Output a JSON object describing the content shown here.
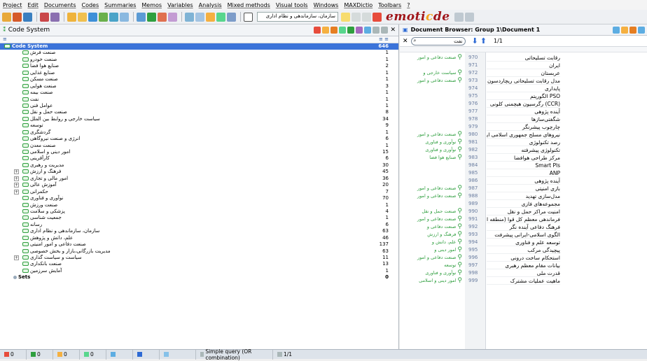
{
  "menu": [
    "Project",
    "Edit",
    "Documents",
    "Codes",
    "Summaries",
    "Memos",
    "Variables",
    "Analysis",
    "Mixed methods",
    "Visual tools",
    "Windows",
    "MAXDictio",
    "Toolbars",
    "?"
  ],
  "toolbar": {
    "filter_value": "سازمان، سازماندهی و نظام اداری",
    "logo_a": "emoti",
    "logo_b": "c",
    "logo_c": "de"
  },
  "code_system": {
    "title": "Code System",
    "col_left": "≡",
    "col_right": "≡ ≡",
    "root": {
      "label": "Code System",
      "count": "646"
    },
    "codes": [
      {
        "label": "صنعت فرش",
        "count": "1",
        "exp": false
      },
      {
        "label": "صنعت خودرو",
        "count": "1",
        "exp": false
      },
      {
        "label": "صنایع هوا فضا",
        "count": "2",
        "exp": false
      },
      {
        "label": "صنایع غذایی",
        "count": "1",
        "exp": false
      },
      {
        "label": "صنعت مسکن",
        "count": "1",
        "exp": false
      },
      {
        "label": "صنعت هوایی",
        "count": "3",
        "exp": false
      },
      {
        "label": "صنعت بیمه",
        "count": "1",
        "exp": false
      },
      {
        "label": "نفت",
        "count": "1",
        "exp": false
      },
      {
        "label": "عوامل فنی",
        "count": "1",
        "exp": false
      },
      {
        "label": "صنعت حمل و نقل",
        "count": "8",
        "exp": false
      },
      {
        "label": "سیاست خارجی و روابط بین الملل",
        "count": "34",
        "exp": false
      },
      {
        "label": "توسعه",
        "count": "9",
        "exp": false
      },
      {
        "label": "گردشگری",
        "count": "1",
        "exp": false
      },
      {
        "label": "انرژی و صنعت نیروگاهی",
        "count": "6",
        "exp": false
      },
      {
        "label": "صنعت معدن",
        "count": "1",
        "exp": false
      },
      {
        "label": "امور دینی و اسلامی",
        "count": "15",
        "exp": false
      },
      {
        "label": "کارآفرینی",
        "count": "6",
        "exp": false
      },
      {
        "label": "مدیریت و رهبری",
        "count": "30",
        "exp": false
      },
      {
        "label": "فرهنگ و ارزش",
        "count": "45",
        "exp": true
      },
      {
        "label": "امور مالی و تجاری",
        "count": "36",
        "exp": true
      },
      {
        "label": "آموزش عالی",
        "count": "20",
        "exp": true
      },
      {
        "label": "حکمرانی",
        "count": "7",
        "exp": true
      },
      {
        "label": "نوآوری و فناوری",
        "count": "70",
        "exp": false
      },
      {
        "label": "صنعت ورزش",
        "count": "1",
        "exp": false
      },
      {
        "label": "پزشکی و سلامت",
        "count": "4",
        "exp": false
      },
      {
        "label": "جمعیت شناسی",
        "count": "1",
        "exp": false
      },
      {
        "label": "رسانه",
        "count": "6",
        "exp": false
      },
      {
        "label": "سازمان، سازماندهی و نظام اداری",
        "count": "63",
        "exp": false
      },
      {
        "label": "علم، دانش و پژوهش",
        "count": "46",
        "exp": false
      },
      {
        "label": "صنعت دفاعی و امور امنیتی",
        "count": "137",
        "exp": false
      },
      {
        "label": "مدیریت بازرگانی،بازار و بخش خصوصی",
        "count": "63",
        "exp": false
      },
      {
        "label": "سیاست و سیاست گذاری",
        "count": "11",
        "exp": true
      },
      {
        "label": "صنعت بانکداری",
        "count": "13",
        "exp": false
      },
      {
        "label": "آمایش سرزمین",
        "count": "1",
        "exp": false
      }
    ],
    "sets": {
      "label": "Sets",
      "count": "0"
    }
  },
  "doc_browser": {
    "title": "Document Browser: Group 1\\Document 1",
    "search_value": "نفت",
    "page": "1/1",
    "lines": [
      {
        "n": "970",
        "t": "رقابت تسلیحاتی"
      },
      {
        "n": "971",
        "t": "ایران"
      },
      {
        "n": "972",
        "t": "عربستان"
      },
      {
        "n": "973",
        "t": "مدل رقابت تسلیحاتی ریچاردسون"
      },
      {
        "n": "974",
        "t": "پایداری"
      },
      {
        "n": "975",
        "t": "PSO الگوریتم"
      },
      {
        "n": "976",
        "t": "(CCR) رگرسیون هیچمنی کلونی"
      },
      {
        "n": "977",
        "t": "آینده پژوهی"
      },
      {
        "n": "978",
        "t": "شگفتی‌سازها"
      },
      {
        "n": "979",
        "t": "چارچوب پیشرنگر"
      },
      {
        "n": "980",
        "t": "نیروهای مسلح جمهوری اسلامی ایران"
      },
      {
        "n": "981",
        "t": "رصد تکنولوژی"
      },
      {
        "n": "982",
        "t": "تکنولوژی پیشرفته"
      },
      {
        "n": "983",
        "t": "مرکز طراحی هوافضا"
      },
      {
        "n": "984",
        "t": "Smart Pls"
      },
      {
        "n": "985",
        "t": "ANP"
      },
      {
        "n": "986",
        "t": "آینده پژوهی"
      },
      {
        "n": "987",
        "t": "بازی امنیتی"
      },
      {
        "n": "988",
        "t": "مدل‌سازی تهدید"
      },
      {
        "n": "989",
        "t": "مجموعه‌های فازی"
      },
      {
        "n": "990",
        "t": "امنیت مراکز حمل و نقل"
      },
      {
        "n": "991",
        "t": "فرماندهی معظم کل قوا (منطقه العالی)"
      },
      {
        "n": "992",
        "t": "فرهنگ دفاعی آینده نگر"
      },
      {
        "n": "993",
        "t": "الگوی اسلامی-ایرانی پیشرفت"
      },
      {
        "n": "994",
        "t": "توسعه علم و فناوری"
      },
      {
        "n": "995",
        "t": "پیچیدگی مرکب"
      },
      {
        "n": "996",
        "t": "استحکام ساخت درونی"
      },
      {
        "n": "997",
        "t": "بیانات مقام معظم رهبری"
      },
      {
        "n": "998",
        "t": "قدرت ملی"
      },
      {
        "n": "999",
        "t": "ماهیت عملیات مشترک"
      }
    ],
    "codings": [
      {
        "row": 0,
        "label": "صنعت دفاعی و امور"
      },
      {
        "row": 2,
        "label": "سیاست خارجی و"
      },
      {
        "row": 3,
        "label": "صنعت دفاعی و امور"
      },
      {
        "row": 10,
        "label": "صنعت دفاعی و امور"
      },
      {
        "row": 11,
        "label": "نوآوری و فناوری"
      },
      {
        "row": 12,
        "label": "نوآوری و فناوری"
      },
      {
        "row": 13,
        "label": "صنایع هوا فضا"
      },
      {
        "row": 17,
        "label": "صنعت دفاعی و امور"
      },
      {
        "row": 18,
        "label": "صنعت دفاعی و امور"
      },
      {
        "row": 20,
        "label": "صنعت حمل و نقل"
      },
      {
        "row": 21,
        "label": "صنعت دفاعی و امور"
      },
      {
        "row": 22,
        "label": "صنعت دفاعی و"
      },
      {
        "row": 23,
        "label": "فرهنگ و ارزش"
      },
      {
        "row": 24,
        "label": "علم، دانش و"
      },
      {
        "row": 25,
        "label": "امور دینی و"
      },
      {
        "row": 26,
        "label": "صنعت دفاعی و امور"
      },
      {
        "row": 27,
        "label": "توسعه"
      },
      {
        "row": 28,
        "label": "نوآوری و فناوری"
      },
      {
        "row": 29,
        "label": "امور دینی و اسلامی"
      }
    ]
  },
  "status": {
    "items": [
      "0",
      "0",
      "0",
      "0",
      "",
      "",
      ""
    ],
    "query": "Simple query (OR combination)",
    "pages": "1/1"
  }
}
